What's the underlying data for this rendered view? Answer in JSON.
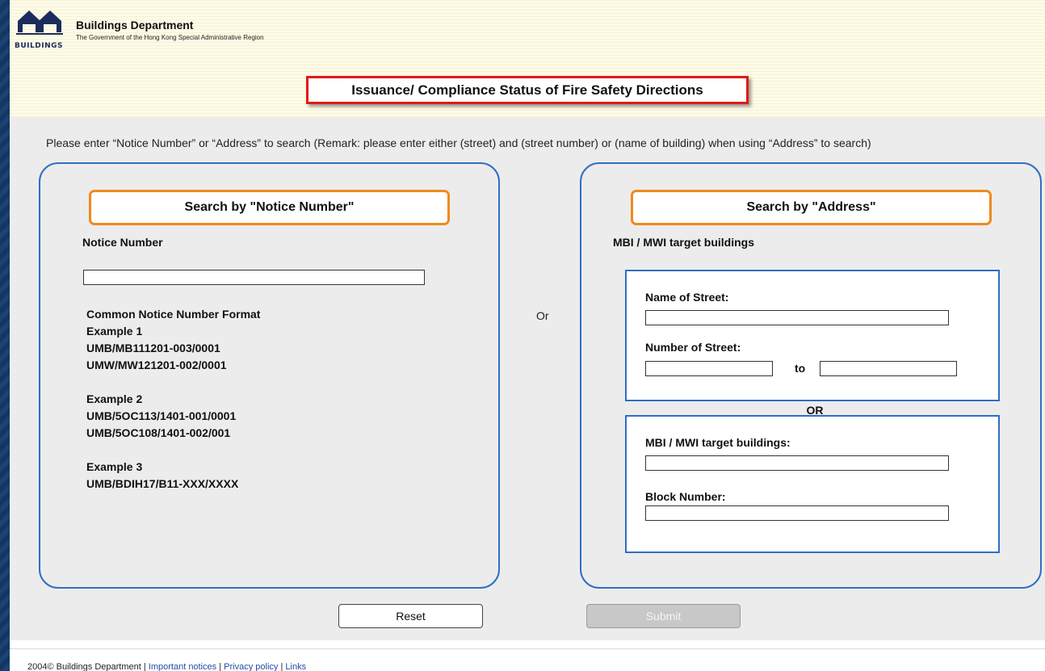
{
  "header": {
    "logo_text": "BUILDINGS",
    "dept_name": "Buildings Department",
    "dept_subtitle": "The Government of the Hong Kong Special Administrative Region"
  },
  "page_title": "Issuance/ Compliance Status of Fire Safety Directions",
  "instructions": "Please enter “Notice Number” or “Address” to search (Remark: please enter either (street) and (street number) or (name of building) when using “Address” to search)",
  "notice_panel": {
    "heading": "Search by \"Notice Number\"",
    "field_label": "Notice Number",
    "field_value": "",
    "format_title": "Common Notice Number Format",
    "examples": [
      {
        "label": "Example 1",
        "lines": [
          "UMB/MB111201-003/0001",
          "UMW/MW121201-002/0001"
        ]
      },
      {
        "label": "Example 2",
        "lines": [
          "UMB/5OC113/1401-001/0001",
          "UMB/5OC108/1401-002/001"
        ]
      },
      {
        "label": "Example 3",
        "lines": [
          "UMB/BDIH17/B11-XXX/XXXX"
        ]
      }
    ]
  },
  "or_between": "Or",
  "address_panel": {
    "heading": "Search by \"Address\"",
    "subheading": "MBI / MWI target buildings",
    "street_name_label": "Name of Street:",
    "street_name_value": "",
    "street_number_label": "Number of Street:",
    "street_number_from": "",
    "to_label": "to",
    "street_number_to": "",
    "or_label": "OR",
    "building_label": "MBI / MWI target buildings:",
    "building_value": "",
    "block_label": "Block Number:",
    "block_value": ""
  },
  "buttons": {
    "reset": "Reset",
    "submit": "Submit"
  },
  "footer": {
    "copyright": "2004© Buildings Department",
    "sep": " | ",
    "important_notices": "Important notices",
    "privacy_policy": "Privacy policy",
    "links": "Links"
  },
  "colors": {
    "panel_border": "#2f6ec4",
    "heading_border": "#f08a1d",
    "title_border": "#e0191b",
    "link": "#1c4ea8"
  }
}
